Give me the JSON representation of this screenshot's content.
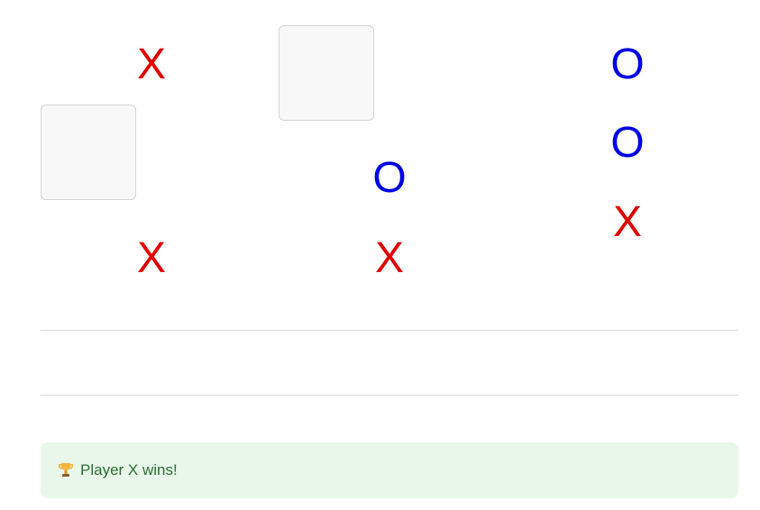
{
  "board": {
    "cells": [
      {
        "row": 1,
        "col": 1,
        "value": ""
      },
      {
        "row": 0,
        "col": 2,
        "value": ""
      },
      {
        "row": 0,
        "col": 1,
        "value": "X"
      },
      {
        "row": 0,
        "col": 8,
        "value": "O"
      },
      {
        "row": 1,
        "col": 8,
        "value": "O"
      },
      {
        "row": 2,
        "col": 5,
        "value": "O"
      },
      {
        "row": 2,
        "col": 8,
        "value": "X"
      },
      {
        "row": 3,
        "col": 1,
        "value": "X"
      },
      {
        "row": 3,
        "col": 5,
        "value": "X"
      }
    ]
  },
  "status": {
    "icon": "trophy-icon",
    "message": "Player X wins!"
  },
  "colors": {
    "x": "#e00000",
    "o": "#0000e6",
    "success_bg": "#e8f7ea",
    "success_text": "#2f6b34"
  }
}
